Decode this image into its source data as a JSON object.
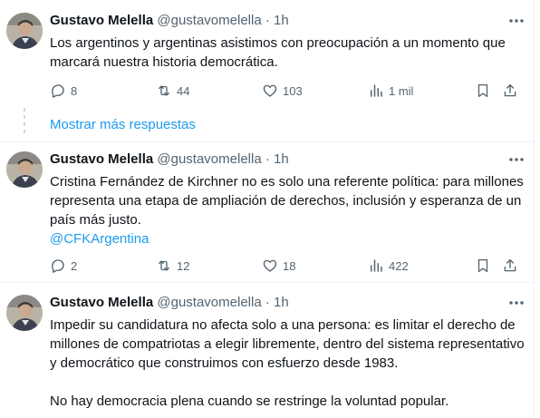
{
  "tweets": [
    {
      "author": "Gustavo Melella",
      "handle": "@gustavomelella",
      "separator": "·",
      "time": "1h",
      "text": "Los argentinos y argentinas asistimos con preocupación a un momento que marcará nuestra historia democrática.",
      "replies": "8",
      "retweets": "44",
      "likes": "103",
      "views": "1 mil"
    },
    {
      "author": "Gustavo Melella",
      "handle": "@gustavomelella",
      "separator": "·",
      "time": "1h",
      "text": "Cristina Fernández de Kirchner no es solo una referente política: para millones representa una etapa de ampliación de derechos, inclusión y esperanza de un país más justo.",
      "mention": "@CFKArgentina",
      "replies": "2",
      "retweets": "12",
      "likes": "18",
      "views": "422"
    },
    {
      "author": "Gustavo Melella",
      "handle": "@gustavomelella",
      "separator": "·",
      "time": "1h",
      "text": "Impedir su candidatura no afecta solo a una persona: es limitar el derecho de millones de compatriotas a elegir libremente, dentro del sistema representativo y democrático que construimos con esfuerzo desde 1983.",
      "text2": "No hay democracia plena cuando se restringe la voluntad popular."
    }
  ],
  "show_more_label": "Mostrar más respuestas",
  "colors": {
    "text": "#0f1419",
    "secondary": "#536471",
    "link": "#1d9bf0",
    "thread_line": "#cfd9de",
    "divider": "#eff3f4"
  },
  "icons": {
    "more": "ellipsis-icon",
    "reply": "reply-icon",
    "retweet": "retweet-icon",
    "like": "heart-icon",
    "views": "bar-chart-icon",
    "bookmark": "bookmark-icon",
    "share": "share-icon"
  }
}
